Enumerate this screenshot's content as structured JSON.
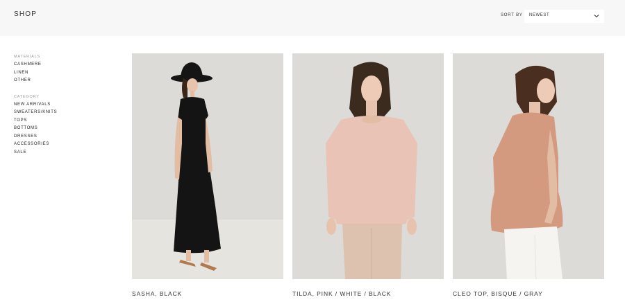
{
  "header": {
    "title": "SHOP",
    "sort_label": "SORT BY",
    "sort_value": "NEWEST"
  },
  "sidebar": {
    "materials_heading": "MATERIALS",
    "materials": [
      "CASHMERE",
      "LINEN",
      "OTHER"
    ],
    "category_heading": "CATEGORY",
    "categories": [
      "NEW ARRIVALS",
      "SWEATERS/KNITS",
      "TOPS",
      "BOTTOMS",
      "DRESSES",
      "ACCESSORIES",
      "SALE"
    ]
  },
  "products": [
    {
      "name": "SASHA, BLACK"
    },
    {
      "name": "TILDA, PINK / WHITE / BLACK"
    },
    {
      "name": "CLEO TOP, BISQUE / GRAY"
    }
  ],
  "colors": {
    "header_bg": "#f7f7f7",
    "photo_bg": "#dcdbd8",
    "dress_black": "#141414",
    "top_pink": "#e9c3b6",
    "top_bisque": "#d49a80"
  }
}
